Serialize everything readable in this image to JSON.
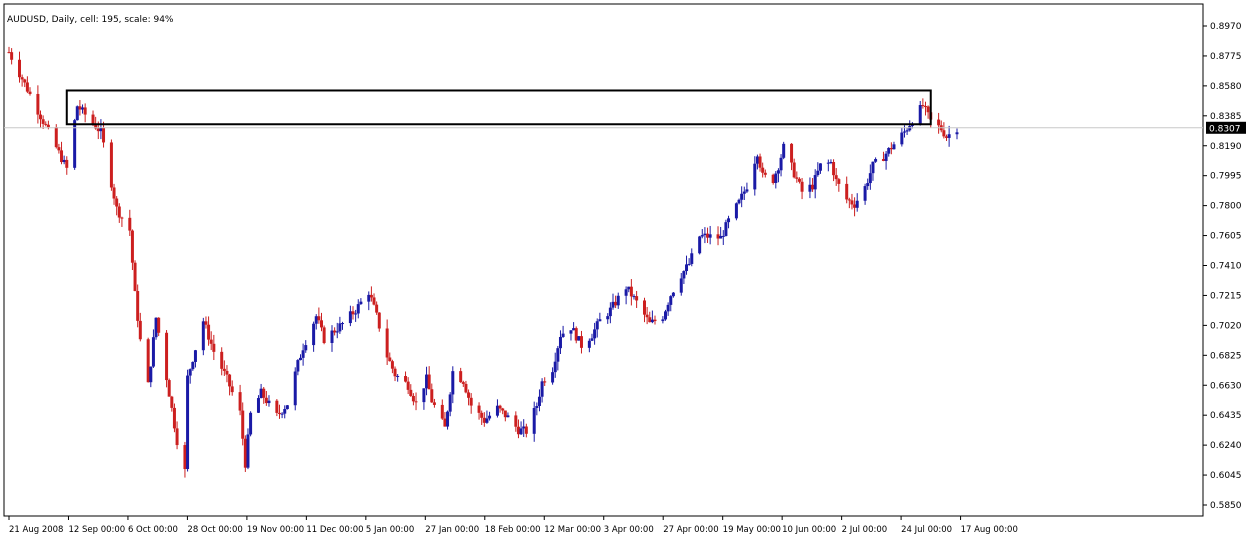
{
  "header": {
    "caption": "AUDUSD, Daily, cell: 195, scale: 94%"
  },
  "price_axis": {
    "ticks": [
      "0.8970",
      "0.8775",
      "0.8580",
      "0.8385",
      "0.8190",
      "0.7995",
      "0.7800",
      "0.7605",
      "0.7410",
      "0.7215",
      "0.7020",
      "0.6825",
      "0.6630",
      "0.6435",
      "0.6240",
      "0.6045",
      "0.5850"
    ],
    "current_price": "0.8307"
  },
  "time_axis": {
    "labels": [
      "21 Aug 2008",
      "12 Sep 00:00",
      "6 Oct 00:00",
      "28 Oct 00:00",
      "19 Nov 00:00",
      "11 Dec 00:00",
      "5 Jan 00:00",
      "27 Jan 00:00",
      "18 Feb 00:00",
      "12 Mar 00:00",
      "3 Apr 00:00",
      "27 Apr 00:00",
      "19 May 00:00",
      "10 Jun 00:00",
      "2 Jul 00:00",
      "24 Jul 00:00",
      "17 Aug 00:00"
    ]
  },
  "colors": {
    "bull": "#1a1aa6",
    "bear": "#cc1f1f",
    "grid": "#c8c8c8",
    "frame": "#000000"
  },
  "chart_data": {
    "type": "candlestick",
    "title": "AUDUSD, Daily, cell: 195, scale: 94%",
    "symbol": "AUDUSD",
    "timeframe": "Daily",
    "ylim": [
      0.585,
      0.897
    ],
    "x_range": [
      "21 Aug 2008",
      "17 Aug 2009"
    ],
    "current_price": 0.8307,
    "series": [
      {
        "close_path": [
          [
            "21 Aug 2008",
            0.88
          ],
          [
            "12 Sep 2008",
            0.804
          ],
          [
            "16 Sep 2008",
            0.845
          ],
          [
            "25 Sep 2008",
            0.828
          ],
          [
            "1 Oct 2008",
            0.778
          ],
          [
            "6 Oct 2008",
            0.764
          ],
          [
            "8 Oct 2008",
            0.722
          ],
          [
            "10 Oct 2008",
            0.692
          ],
          [
            "13 Oct 2008",
            0.663
          ],
          [
            "16 Oct 2008",
            0.707
          ],
          [
            "20 Oct 2008",
            0.668
          ],
          [
            "24 Oct 2008",
            0.627
          ],
          [
            "27 Oct 2008",
            0.607
          ],
          [
            "28 Oct 2008",
            0.668
          ],
          [
            "31 Oct 2008",
            0.687
          ],
          [
            "3 Nov 2008",
            0.705
          ],
          [
            "7 Nov 2008",
            0.685
          ],
          [
            "12 Nov 2008",
            0.667
          ],
          [
            "17 Nov 2008",
            0.645
          ],
          [
            "19 Nov 2008",
            0.612
          ],
          [
            "21 Nov 2008",
            0.644
          ],
          [
            "25 Nov 2008",
            0.658
          ],
          [
            "1 Dec 2008",
            0.643
          ],
          [
            "5 Dec 2008",
            0.651
          ],
          [
            "9 Dec 2008",
            0.677
          ],
          [
            "11 Dec 2008",
            0.688
          ],
          [
            "16 Dec 2008",
            0.708
          ],
          [
            "19 Dec 2008",
            0.693
          ],
          [
            "26 Dec 2008",
            0.703
          ],
          [
            "31 Dec 2008",
            0.712
          ],
          [
            "5 Jan 2009",
            0.724
          ],
          [
            "8 Jan 2009",
            0.708
          ],
          [
            "12 Jan 2009",
            0.682
          ],
          [
            "15 Jan 2009",
            0.67
          ],
          [
            "20 Jan 2009",
            0.663
          ],
          [
            "23 Jan 2009",
            0.651
          ],
          [
            "27 Jan 2009",
            0.667
          ],
          [
            "29 Jan 2009",
            0.653
          ],
          [
            "3 Feb 2009",
            0.635
          ],
          [
            "6 Feb 2009",
            0.672
          ],
          [
            "10 Feb 2009",
            0.666
          ],
          [
            "13 Feb 2009",
            0.65
          ],
          [
            "18 Feb 2009",
            0.64
          ],
          [
            "23 Feb 2009",
            0.648
          ],
          [
            "27 Feb 2009",
            0.642
          ],
          [
            "3 Mar 2009",
            0.634
          ],
          [
            "6 Mar 2009",
            0.633
          ],
          [
            "10 Mar 2009",
            0.65
          ],
          [
            "12 Mar 2009",
            0.665
          ],
          [
            "16 Mar 2009",
            0.674
          ],
          [
            "19 Mar 2009",
            0.696
          ],
          [
            "23 Mar 2009",
            0.701
          ],
          [
            "27 Mar 2009",
            0.689
          ],
          [
            "31 Mar 2009",
            0.696
          ],
          [
            "3 Apr 2009",
            0.705
          ],
          [
            "7 Apr 2009",
            0.712
          ],
          [
            "13 Apr 2009",
            0.727
          ],
          [
            "17 Apr 2009",
            0.717
          ],
          [
            "22 Apr 2009",
            0.703
          ],
          [
            "27 Apr 2009",
            0.708
          ],
          [
            "30 Apr 2009",
            0.722
          ],
          [
            "4 May 2009",
            0.735
          ],
          [
            "7 May 2009",
            0.742
          ],
          [
            "11 May 2009",
            0.76
          ],
          [
            "14 May 2009",
            0.76
          ],
          [
            "19 May 2009",
            0.759
          ],
          [
            "22 May 2009",
            0.77
          ],
          [
            "26 May 2009",
            0.782
          ],
          [
            "29 May 2009",
            0.793
          ],
          [
            "2 Jun 2009",
            0.815
          ],
          [
            "4 Jun 2009",
            0.799
          ],
          [
            "8 Jun 2009",
            0.797
          ],
          [
            "10 Jun 2009",
            0.806
          ],
          [
            "12 Jun 2009",
            0.818
          ],
          [
            "16 Jun 2009",
            0.801
          ],
          [
            "19 Jun 2009",
            0.789
          ],
          [
            "23 Jun 2009",
            0.793
          ],
          [
            "26 Jun 2009",
            0.806
          ],
          [
            "30 Jun 2009",
            0.808
          ],
          [
            "2 Jul 2009",
            0.796
          ],
          [
            "6 Jul 2009",
            0.784
          ],
          [
            "9 Jul 2009",
            0.781
          ],
          [
            "13 Jul 2009",
            0.792
          ],
          [
            "16 Jul 2009",
            0.806
          ],
          [
            "20 Jul 2009",
            0.812
          ],
          [
            "24 Jul 2009",
            0.82
          ],
          [
            "28 Jul 2009",
            0.828
          ],
          [
            "31 Jul 2009",
            0.836
          ],
          [
            "4 Aug 2009",
            0.845
          ],
          [
            "7 Aug 2009",
            0.835
          ],
          [
            "11 Aug 2009",
            0.83
          ],
          [
            "13 Aug 2009",
            0.825
          ],
          [
            "17 Aug 2009",
            0.8307
          ]
        ]
      }
    ],
    "annotations": [
      {
        "type": "rectangle",
        "from": "12 Sep 2008",
        "to": "7 Aug 2009",
        "price_top": 0.855,
        "price_bottom": 0.833
      }
    ]
  }
}
